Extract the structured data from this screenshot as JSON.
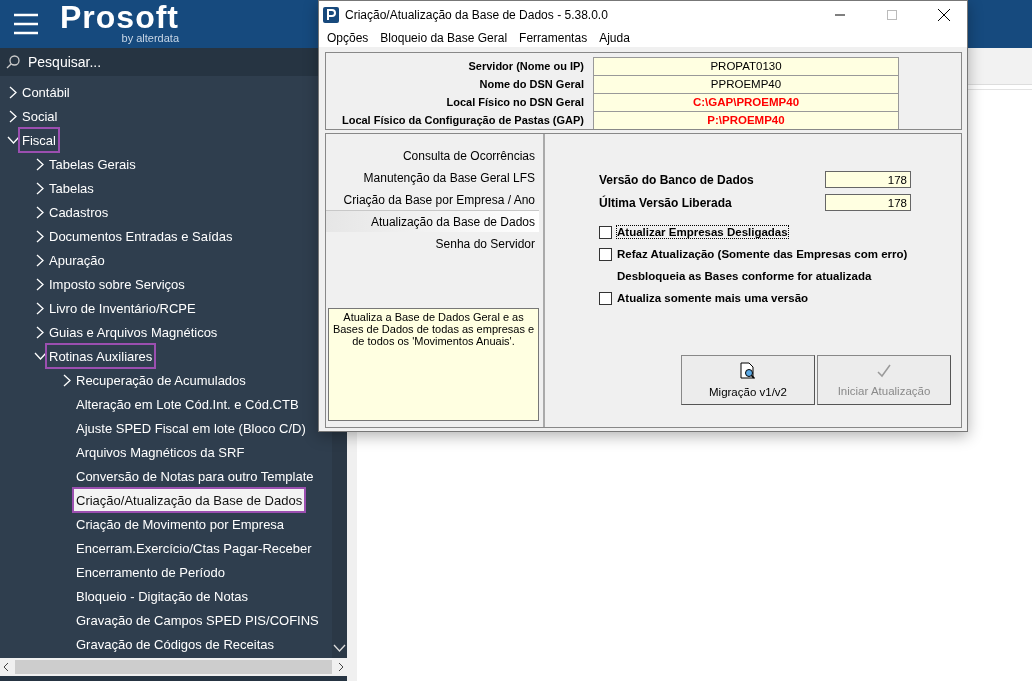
{
  "header": {
    "logo": {
      "name": "Prosoft",
      "tagline": "by alterdata"
    }
  },
  "sidebar": {
    "search": {
      "placeholder": "Pesquisar..."
    },
    "tree": [
      {
        "label": "Contábil",
        "expanded": false,
        "marked": false,
        "selected": false
      },
      {
        "label": "Social",
        "expanded": false,
        "marked": false,
        "selected": false
      },
      {
        "label": "Fiscal",
        "expanded": true,
        "marked": true,
        "selected": false,
        "children": [
          {
            "label": "Tabelas Gerais",
            "expanded": false,
            "marked": false,
            "selected": false
          },
          {
            "label": "Tabelas",
            "expanded": false,
            "marked": false,
            "selected": false
          },
          {
            "label": "Cadastros",
            "expanded": false,
            "marked": false,
            "selected": false
          },
          {
            "label": "Documentos Entradas e Saídas",
            "expanded": false,
            "marked": false,
            "selected": false
          },
          {
            "label": "Apuração",
            "expanded": false,
            "marked": false,
            "selected": false
          },
          {
            "label": "Imposto sobre Serviços",
            "expanded": false,
            "marked": false,
            "selected": false
          },
          {
            "label": "Livro de Inventário/RCPE",
            "expanded": false,
            "marked": false,
            "selected": false
          },
          {
            "label": "Guias e Arquivos Magnéticos",
            "expanded": false,
            "marked": false,
            "selected": false
          },
          {
            "label": "Rotinas Auxiliares",
            "expanded": true,
            "marked": true,
            "selected": false,
            "children": [
              {
                "label": "Recuperação de Acumulados",
                "kind": "folder",
                "expanded": false,
                "marked": false,
                "selected": false
              },
              {
                "label": "Alteração em Lote Cód.Int. e Cód.CTB",
                "kind": "leaf",
                "marked": false,
                "selected": false
              },
              {
                "label": "Ajuste SPED Fiscal em lote (Bloco C/D)",
                "kind": "leaf",
                "marked": false,
                "selected": false
              },
              {
                "label": "Arquivos Magnéticos da SRF",
                "kind": "leaf",
                "marked": false,
                "selected": false
              },
              {
                "label": "Conversão de Notas para outro Template",
                "kind": "leaf",
                "marked": false,
                "selected": false
              },
              {
                "label": "Criação/Atualização da Base de Dados",
                "kind": "leaf",
                "marked": true,
                "selected": true
              },
              {
                "label": "Criação de Movimento por Empresa",
                "kind": "leaf",
                "marked": false,
                "selected": false
              },
              {
                "label": "Encerram.Exercício/Ctas Pagar-Receber",
                "kind": "leaf",
                "marked": false,
                "selected": false
              },
              {
                "label": "Encerramento de Período",
                "kind": "leaf",
                "marked": false,
                "selected": false
              },
              {
                "label": "Bloqueio - Digitação de Notas",
                "kind": "leaf",
                "marked": false,
                "selected": false
              },
              {
                "label": "Gravação de Campos SPED PIS/COFINS",
                "kind": "leaf",
                "marked": false,
                "selected": false
              },
              {
                "label": "Gravação de Códigos de Receitas",
                "kind": "leaf",
                "marked": false,
                "selected": false
              }
            ]
          }
        ]
      }
    ]
  },
  "dialog": {
    "title": "Criação/Atualização da Base de Dados - 5.38.0.0",
    "menu": [
      "Opções",
      "Bloqueio da Base Geral",
      "Ferramentas",
      "Ajuda"
    ],
    "fields": [
      {
        "label": "Servidor (Nome ou IP)",
        "value": "PROPAT0130",
        "emphasis": false
      },
      {
        "label": "Nome do DSN Geral",
        "value": "PPROEMP40",
        "emphasis": false
      },
      {
        "label": "Local Físico no DSN Geral",
        "value": "C:\\GAP\\PROEMP40",
        "emphasis": true
      },
      {
        "label": "Local Físico da Configuração de Pastas (GAP)",
        "value": "P:\\PROEMP40",
        "emphasis": true
      }
    ],
    "nav": [
      {
        "label": "Consulta de Ocorrências",
        "selected": false
      },
      {
        "label": "Manutenção da Base Geral LFS",
        "selected": false
      },
      {
        "label": "Criação da Base por Empresa / Ano",
        "selected": false
      },
      {
        "label": "Atualização da Base de Dados",
        "selected": true
      },
      {
        "label": "Senha do Servidor",
        "selected": false
      }
    ],
    "description": "Atualiza a Base de Dados Geral e as Bases de Dados de todas as empresas e de todos os 'Movimentos Anuais'.",
    "versions": [
      {
        "label": "Versão do Banco de Dados",
        "value": "178"
      },
      {
        "label": "Última Versão Liberada",
        "value": "178"
      }
    ],
    "options": [
      {
        "kind": "checkbox",
        "label": "Atualizar Empresas Desligadas",
        "checked": false,
        "focused": true
      },
      {
        "kind": "checkbox",
        "label": "Refaz Atualização (Somente das Empresas com erro)",
        "checked": false,
        "focused": false
      },
      {
        "kind": "note",
        "label": "Desbloqueia as Bases conforme for atualizada"
      },
      {
        "kind": "checkbox",
        "label": "Atualiza somente mais uma versão",
        "checked": false,
        "focused": false
      }
    ],
    "buttons": [
      {
        "label": "Migração v1/v2",
        "disabled": false
      },
      {
        "label": "Iniciar Atualização",
        "disabled": true
      }
    ]
  }
}
